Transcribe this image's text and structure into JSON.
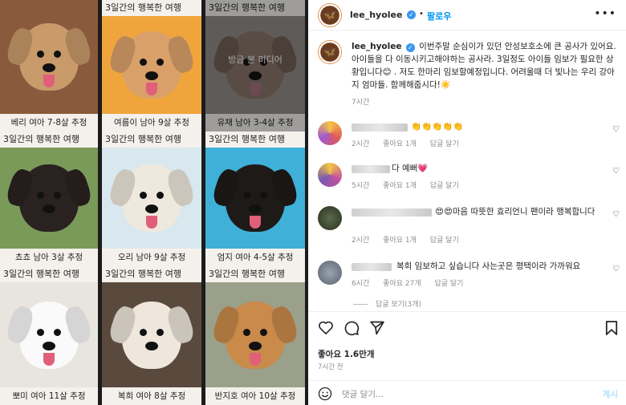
{
  "grid": {
    "hidden_media_label": "방금 본 미디어",
    "cards": [
      {
        "top": "",
        "caption": "베리 여아 7-8살 추정",
        "bg": "#8a5a3c",
        "fur": "#c99a6a"
      },
      {
        "top": "3일간의 행복한 여행",
        "caption": "여름이 남아 9살 추정",
        "bg": "#f0a53c",
        "fur": "#d9a06a"
      },
      {
        "top": "3일간의 행복한 여행",
        "caption": "유채 남아 3-4살 추정",
        "bg": "#9a8a80",
        "fur": "#a07050"
      },
      {
        "top": "3일간의 행복한 여행",
        "caption": "쵸쵸 남아 3살 추정",
        "bg": "#7a9a5a",
        "fur": "#2a2220"
      },
      {
        "top": "3일간의 행복한 여행",
        "caption": "오리 남아 9살 추정",
        "bg": "#d9e8ef",
        "fur": "#efe8dc"
      },
      {
        "top": "3일간의 행복한 여행",
        "caption": "엄지 여아 4-5살 추정",
        "bg": "#3fb0d8",
        "fur": "#1e1a18"
      },
      {
        "top": "3일간의 행복한 여행",
        "caption": "뽀미 여아 11살 추정",
        "bg": "#e8e4de",
        "fur": "#fafafa"
      },
      {
        "top": "3일간의 행복한 여행",
        "caption": "복희 여아 8살 추정",
        "bg": "#5a4a3e",
        "fur": "#efe6dc"
      },
      {
        "top": "3일간의 행복한 여행",
        "caption": "반지호 여아 10살 추정",
        "bg": "#9aa08a",
        "fur": "#c98a4a"
      }
    ]
  },
  "header": {
    "username": "lee_hyolee",
    "separator": "•",
    "follow_label": "팔로우",
    "more_label": "•••"
  },
  "post": {
    "username": "lee_hyolee",
    "caption": "이번주말 순심이가 있던 안성보호소에 큰 공사가 있어요. 아이들을 다 이동시키고해야하는 공사라. 3일정도 아이들 임보가 필요한 상황입니다😊 . 저도 한마리 임보할예정입니다. 어려울때 더 빛나는 우리 강아지 엄마들. 함께해줍시다!☀️",
    "time": "7시간"
  },
  "comments": [
    {
      "text": "👏👏👏👏👏",
      "time": "2시간",
      "likes": "좋아요 1개",
      "reply": "답글 달기"
    },
    {
      "text": "다 예뻐💗",
      "time": "5시간",
      "likes": "좋아요 1개",
      "reply": "답글 달기"
    },
    {
      "text": "😍😍마음 따뜻한 효리언니 팬이라 행복합니다",
      "time": "2시간",
      "likes": "좋아요 1개",
      "reply": "답글 달기"
    },
    {
      "text": "복희 임보하고 싶습니다 사는곳은 평택이라 가까워요",
      "time": "6시간",
      "likes": "좋아요 27개",
      "reply": "답글 달기"
    }
  ],
  "view_replies": "답글 보기(3개)",
  "footer": {
    "likes": "좋아요 1.6만개",
    "posted": "7시간 전",
    "comment_placeholder": "댓글 달기...",
    "post_label": "게시"
  },
  "colors": {
    "accent": "#0095f6",
    "heart": "#ed4956"
  }
}
